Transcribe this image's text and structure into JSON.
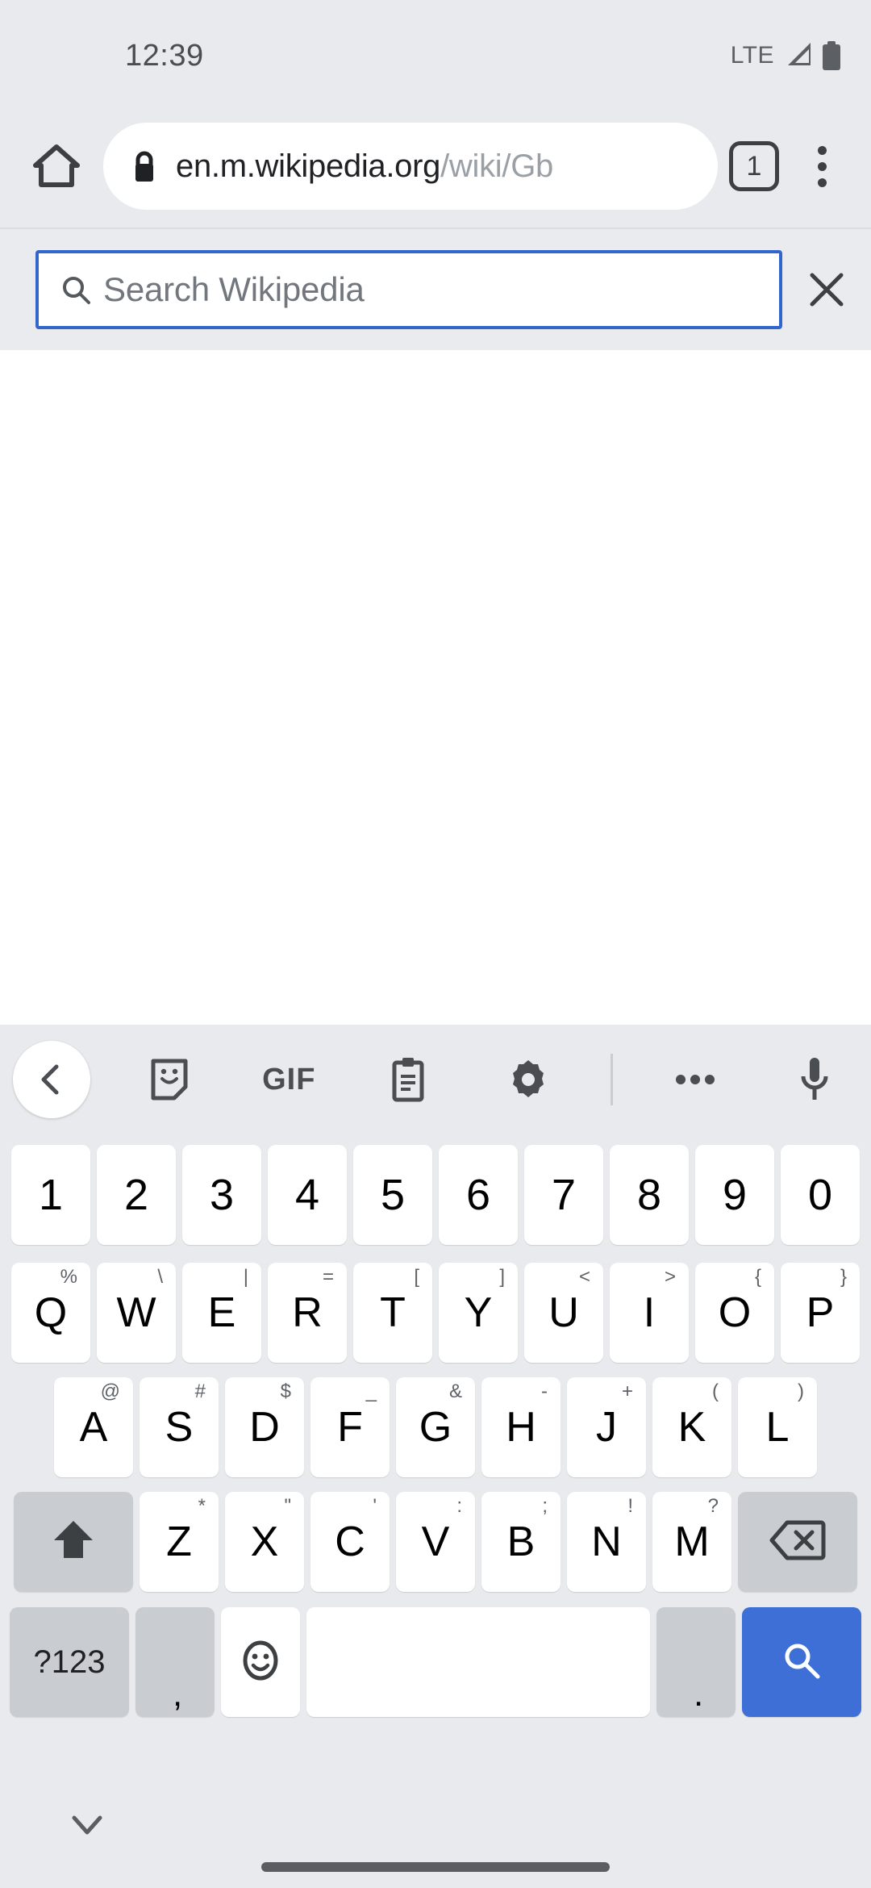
{
  "status_bar": {
    "clock": "12:39",
    "network_label": "LTE",
    "signal_icon": "signal-triangle-icon",
    "battery_icon": "battery-full-icon"
  },
  "browser": {
    "home_icon": "home-icon",
    "lock_icon": "lock-icon",
    "url_domain": "en.m.wikipedia.org",
    "url_path": "/wiki/Gb",
    "tab_count": "1",
    "menu_icon": "kebab-menu-icon"
  },
  "wiki_search": {
    "search_icon": "search-icon",
    "placeholder": "Search Wikipedia",
    "value": "",
    "close_icon": "close-x-icon"
  },
  "keyboard": {
    "toolbar": [
      {
        "name": "back-chevron-icon",
        "label": ""
      },
      {
        "name": "sticker-icon",
        "label": ""
      },
      {
        "name": "gif-icon",
        "label": "GIF"
      },
      {
        "name": "clipboard-icon",
        "label": ""
      },
      {
        "name": "settings-gear-icon",
        "label": ""
      },
      {
        "name": "toolbar-divider",
        "label": ""
      },
      {
        "name": "more-options-icon",
        "label": ""
      },
      {
        "name": "microphone-icon",
        "label": ""
      }
    ],
    "row_numbers": [
      {
        "key": "1"
      },
      {
        "key": "2"
      },
      {
        "key": "3"
      },
      {
        "key": "4"
      },
      {
        "key": "5"
      },
      {
        "key": "6"
      },
      {
        "key": "7"
      },
      {
        "key": "8"
      },
      {
        "key": "9"
      },
      {
        "key": "0"
      }
    ],
    "row_top": [
      {
        "key": "Q",
        "sub": "%"
      },
      {
        "key": "W",
        "sub": "\\"
      },
      {
        "key": "E",
        "sub": "|"
      },
      {
        "key": "R",
        "sub": "="
      },
      {
        "key": "T",
        "sub": "["
      },
      {
        "key": "Y",
        "sub": "]"
      },
      {
        "key": "U",
        "sub": "<"
      },
      {
        "key": "I",
        "sub": ">"
      },
      {
        "key": "O",
        "sub": "{"
      },
      {
        "key": "P",
        "sub": "}"
      }
    ],
    "row_home": [
      {
        "key": "A",
        "sub": "@"
      },
      {
        "key": "S",
        "sub": "#"
      },
      {
        "key": "D",
        "sub": "$"
      },
      {
        "key": "F",
        "sub": "_"
      },
      {
        "key": "G",
        "sub": "&"
      },
      {
        "key": "H",
        "sub": "-"
      },
      {
        "key": "J",
        "sub": "+"
      },
      {
        "key": "K",
        "sub": "("
      },
      {
        "key": "L",
        "sub": ")"
      }
    ],
    "row_bottom": [
      {
        "key": "Z",
        "sub": "*"
      },
      {
        "key": "X",
        "sub": "\""
      },
      {
        "key": "C",
        "sub": "'"
      },
      {
        "key": "V",
        "sub": ":"
      },
      {
        "key": "B",
        "sub": ";"
      },
      {
        "key": "N",
        "sub": "!"
      },
      {
        "key": "M",
        "sub": "?"
      }
    ],
    "shift_icon": "shift-arrow-icon",
    "backspace_icon": "backspace-icon",
    "symbols_label": "?123",
    "comma_label": ",",
    "emoji_icon": "emoji-smiley-icon",
    "space_label": "",
    "period_label": ".",
    "enter_icon": "search-enter-icon",
    "accent_color": "#3d6fd6"
  },
  "nav_bar": {
    "dismiss_icon": "chevron-down-icon",
    "home_pill": "gesture-home-bar"
  }
}
